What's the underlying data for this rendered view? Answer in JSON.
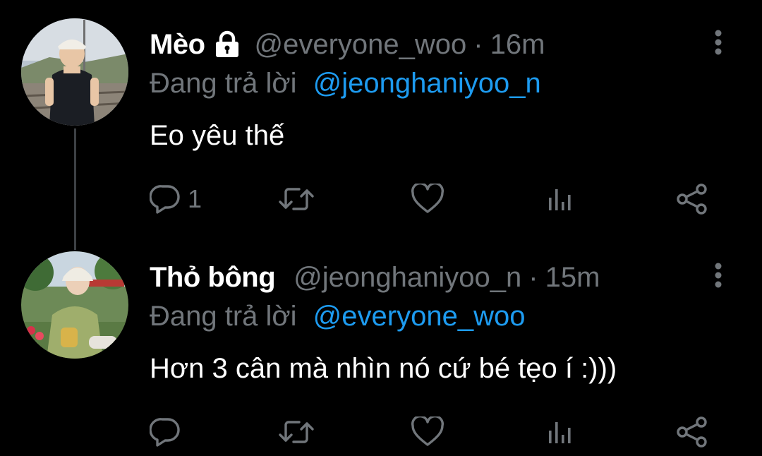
{
  "colors": {
    "background": "#000000",
    "name": "#ffffff",
    "secondary": "#71767b",
    "mention": "#1d9bf0",
    "thread_line": "#3d4145"
  },
  "tweets": [
    {
      "display_name": "Mèo",
      "protected_icon": "lock-icon",
      "handle": "@everyone_woo",
      "separator": "·",
      "time": "16m",
      "reply_prefix": "Đang trả lời",
      "reply_to": "@jeonghaniyoo_n",
      "text": "Eo yêu thế",
      "reply_count": "1",
      "avatar": "avatar-photo-child"
    },
    {
      "display_name": "Thỏ bông",
      "handle": "@jeonghaniyoo_n",
      "separator": "·",
      "time": "15m",
      "reply_prefix": "Đang trả lời",
      "reply_to": "@everyone_woo",
      "text": "Hơn 3 cân mà nhìn nó cứ bé tẹo í :)))",
      "reply_count": "",
      "avatar": "avatar-photo-woman"
    }
  ],
  "action_icons": [
    "reply-icon",
    "retweet-icon",
    "like-icon",
    "views-icon",
    "share-icon"
  ]
}
